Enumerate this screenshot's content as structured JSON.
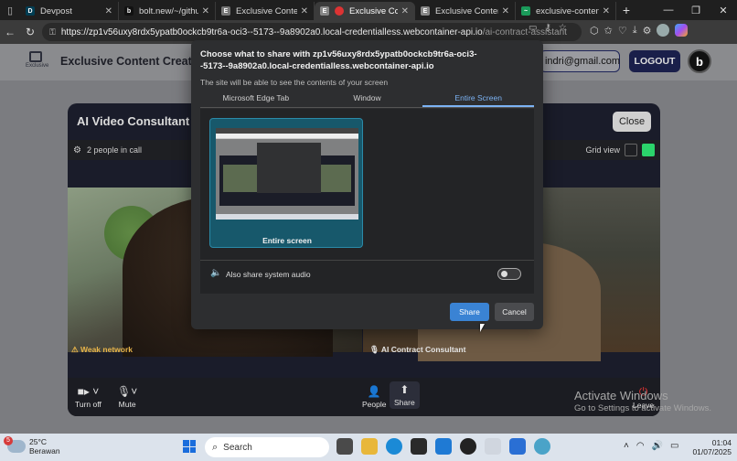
{
  "browser": {
    "tabs": [
      {
        "label": "Devpost",
        "fav": "D",
        "color": "#003e54"
      },
      {
        "label": "bolt.new/~/github-a",
        "fav": "b",
        "color": "#111"
      },
      {
        "label": "Exclusive Content -",
        "fav": "E",
        "color": "#777"
      },
      {
        "label": "Exclusive Conte",
        "fav": "E",
        "color": "#888"
      },
      {
        "label": "Exclusive Content -",
        "fav": "E",
        "color": "#888"
      },
      {
        "label": "exclusive-content-cr",
        "fav": "~",
        "color": "#1a9a5a"
      }
    ],
    "url_host": "https://zp1v56uxy8rdx5ypatb0ockcb9tr6a-oci3--5173--9a8902a0.local-credentialless.webcontainer-api.io",
    "url_path": "/ai-contract-assistant"
  },
  "site": {
    "logo_text": "Exclusive",
    "title": "Exclusive Content Creator",
    "email": "indri@gmail.com",
    "logout_label": "LOGOUT",
    "badge_letter": "b"
  },
  "call": {
    "title": "AI Video Consultant",
    "close_label": "Close",
    "people_count": "2 people in call",
    "grid_view_label": "Grid view",
    "network_warning": "Weak network",
    "participant_name": "AI Contract Consultant",
    "controls": {
      "camera": "Turn off",
      "mute": "Mute",
      "people": "People",
      "share": "Share",
      "leave": "Leave"
    }
  },
  "share_dialog": {
    "title": "Choose what to share with zp1v56uxy8rdx5ypatb0ockcb9tr6a-oci3--5173--9a8902a0.local-credentialless.webcontainer-api.io",
    "subtitle": "The site will be able to see the contents of your screen",
    "tabs": [
      "Microsoft Edge Tab",
      "Window",
      "Entire Screen"
    ],
    "active_tab": "Entire Screen",
    "screen_option": "Entire screen",
    "audio_label": "Also share system audio",
    "audio_enabled": false,
    "share_label": "Share",
    "cancel_label": "Cancel"
  },
  "watermark": {
    "line1": "Activate Windows",
    "line2": "Go to Settings to activate Windows."
  },
  "taskbar": {
    "weather_badge": "5",
    "temperature": "25°C",
    "condition": "Berawan",
    "search_placeholder": "Search",
    "time": "01:04",
    "date": "01/07/2025"
  }
}
